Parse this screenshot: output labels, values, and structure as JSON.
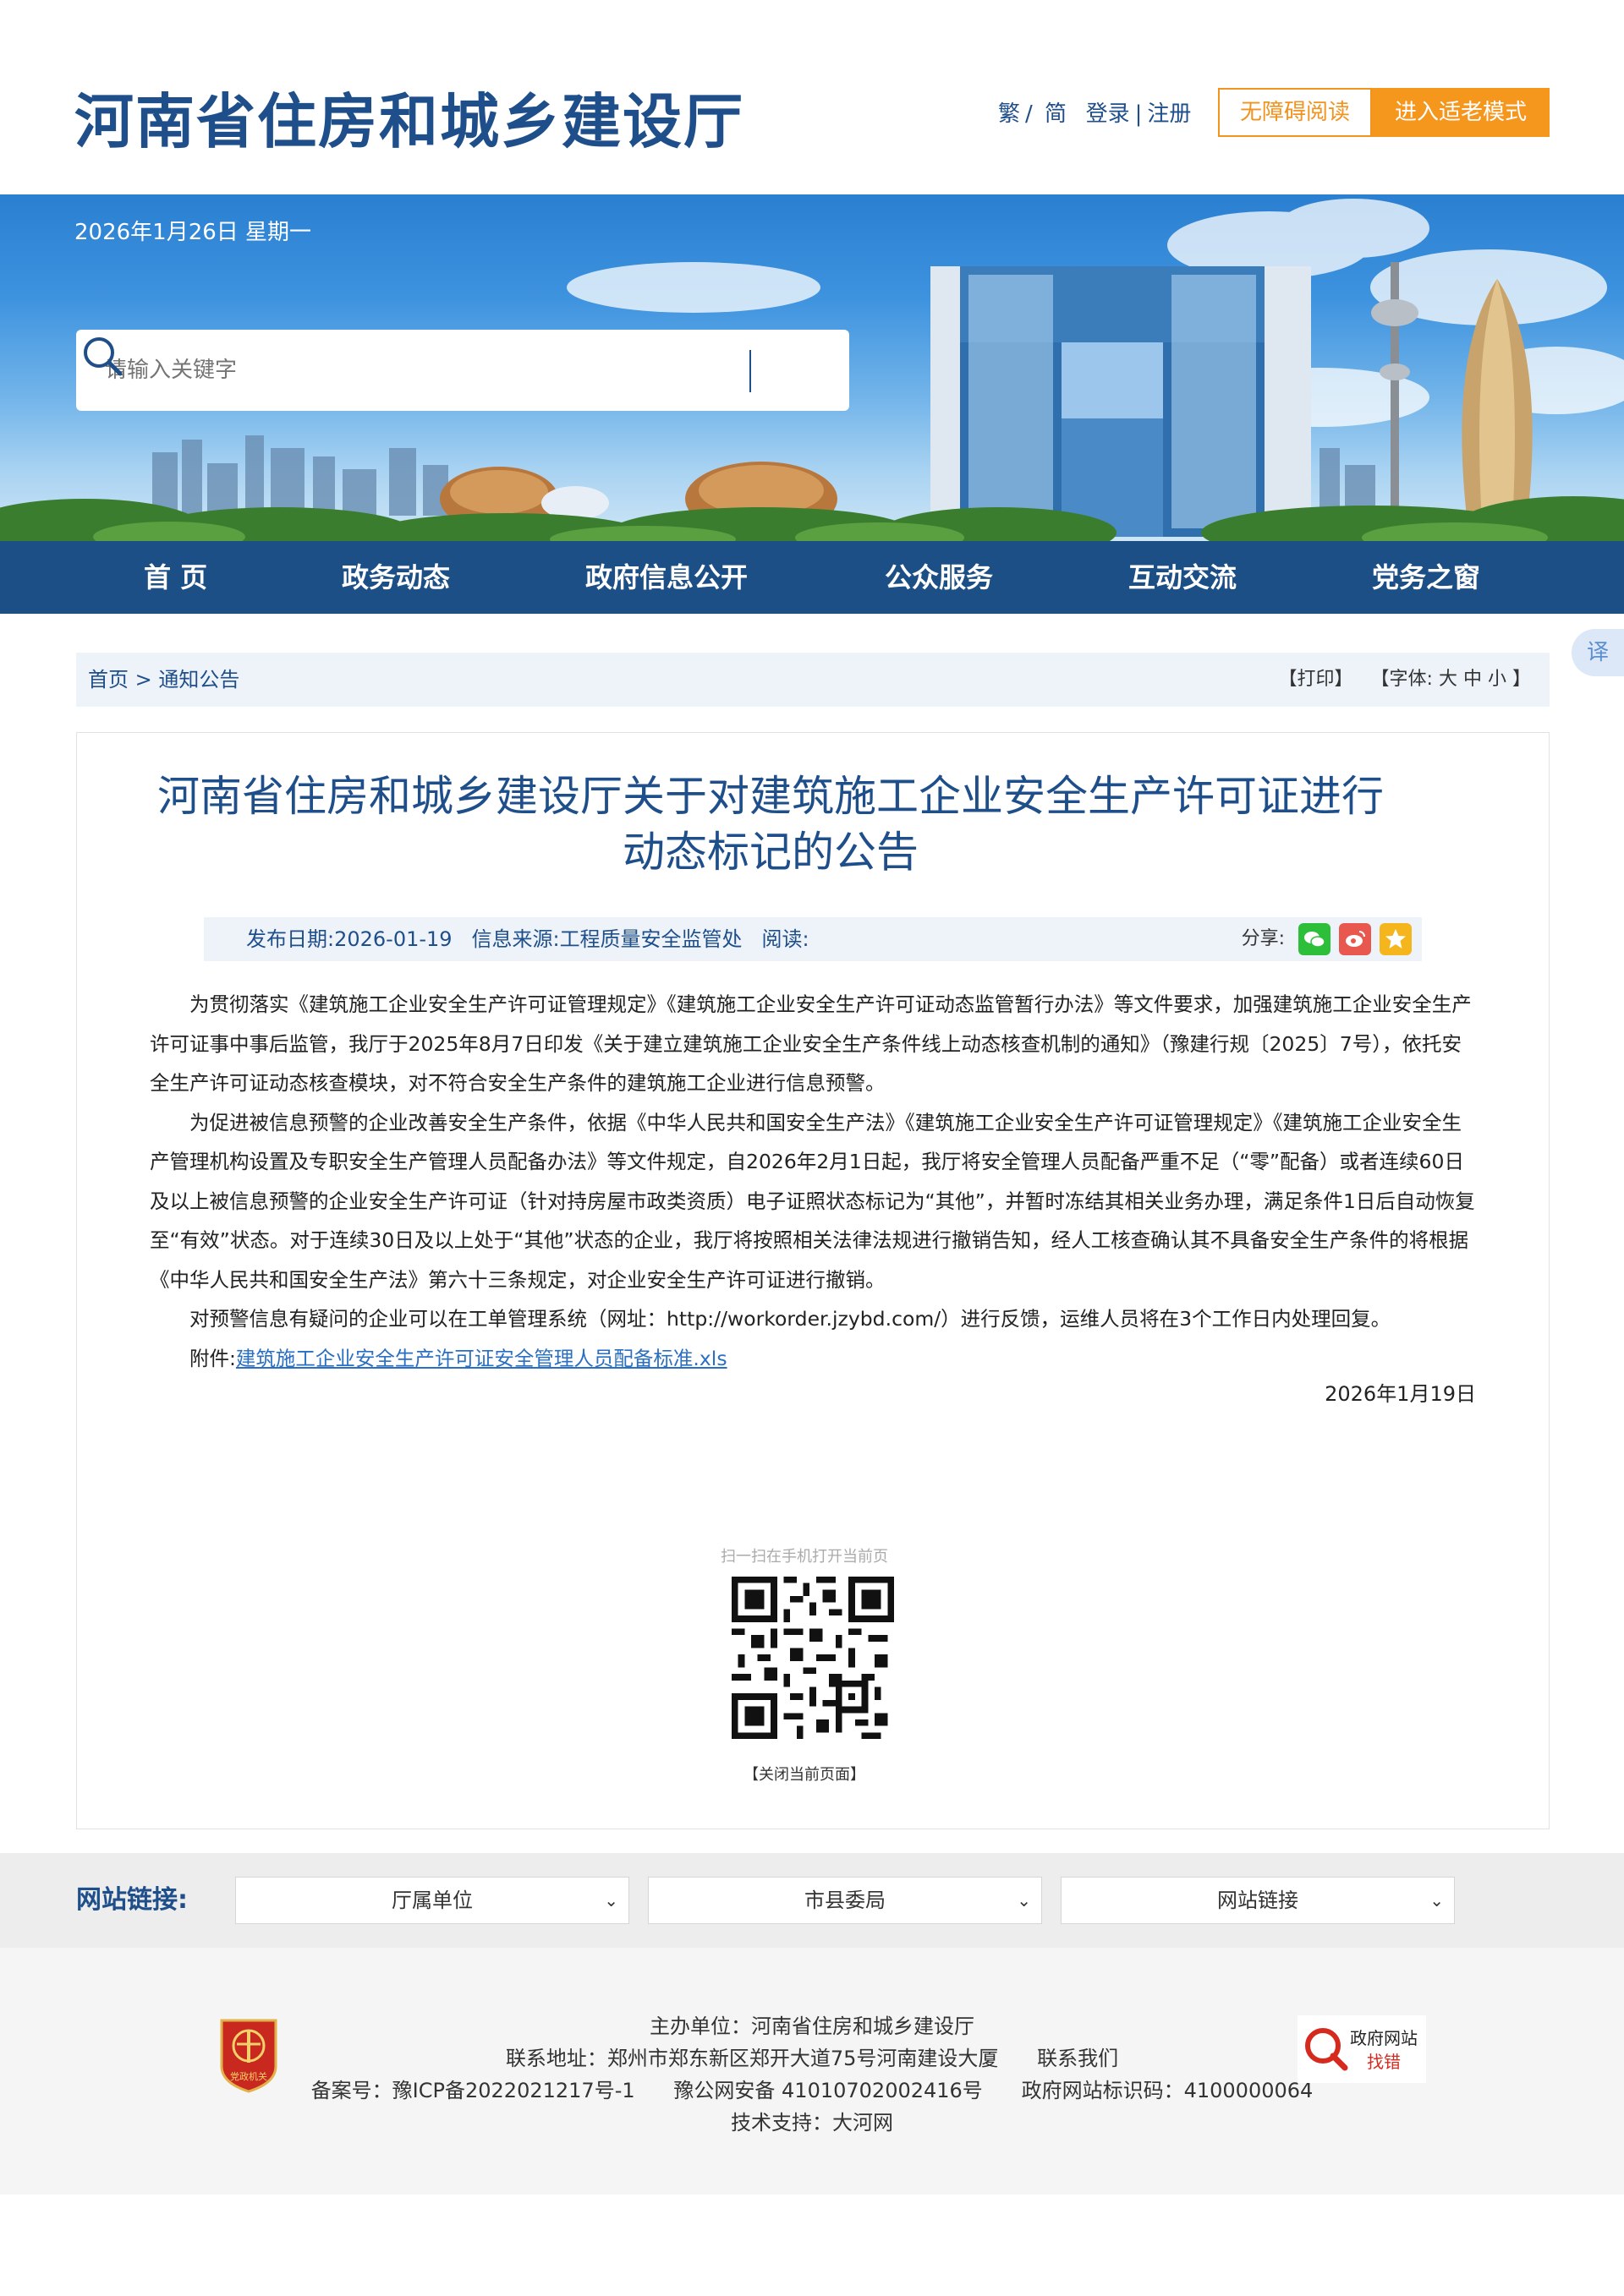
{
  "header": {
    "site_title": "河南省住房和城乡建设厅",
    "lang_traditional": "繁",
    "lang_separator": "/",
    "lang_simplified": "简",
    "login": "登录",
    "auth_separator": "|",
    "register": "注册",
    "accessible_reading": "无障碍阅读",
    "elder_mode": "进入适老模式"
  },
  "banner": {
    "date": "2026年1月26日 星期一"
  },
  "search": {
    "placeholder": "请输入关键字"
  },
  "nav": {
    "items": [
      "首 页",
      "政务动态",
      "政府信息公开",
      "公众服务",
      "互动交流",
      "党务之窗"
    ]
  },
  "translate": {
    "label": "译"
  },
  "breadcrumb": {
    "home": "首页",
    "separator": ">",
    "current": "通知公告",
    "print": "【打印】",
    "font_label": "【字体:",
    "font_large": "大",
    "font_medium": "中",
    "font_small": "小",
    "font_close": "】"
  },
  "article": {
    "title_line1": "河南省住房和城乡建设厅关于对建筑施工企业安全生产许可证进行",
    "title_line2": "动态标记的公告",
    "publish_label": "发布日期:",
    "publish_date": "2026-01-19",
    "source_label": "信息来源:",
    "source": "工程质量安全监管处",
    "views_label": "阅读:",
    "share_label": "分享:",
    "paragraphs": [
      "为贯彻落实《建筑施工企业安全生产许可证管理规定》《建筑施工企业安全生产许可证动态监管暂行办法》等文件要求，加强建筑施工企业安全生产许可证事中事后监管，我厅于2025年8月7日印发《关于建立建筑施工企业安全生产条件线上动态核查机制的通知》（豫建行规〔2025〕7号），依托安全生产许可证动态核查模块，对不符合安全生产条件的建筑施工企业进行信息预警。",
      "为促进被信息预警的企业改善安全生产条件，依据《中华人民共和国安全生产法》《建筑施工企业安全生产许可证管理规定》《建筑施工企业安全生产管理机构设置及专职安全生产管理人员配备办法》等文件规定，自2026年2月1日起，我厅将安全管理人员配备严重不足（“零”配备）或者连续60日及以上被信息预警的企业安全生产许可证（针对持房屋市政类资质）电子证照状态标记为“其他”，并暂时冻结其相关业务办理，满足条件1日后自动恢复至“有效”状态。对于连续30日及以上处于“其他”状态的企业，我厅将按照相关法律法规进行撤销告知，经人工核查确认其不具备安全生产条件的将根据《中华人民共和国安全生产法》第六十三条规定，对企业安全生产许可证进行撤销。",
      "对预警信息有疑问的企业可以在工单管理系统（网址：http://workorder.jzybd.com/）进行反馈，运维人员将在3个工作日内处理回复。"
    ],
    "attachment_label": "附件:",
    "attachment_link": "建筑施工企业安全生产许可证安全管理人员配备标准.xls",
    "date": "2026年1月19日",
    "qr_caption": "扫一扫在手机打开当前页",
    "close_page": "【关闭当前页面】"
  },
  "links": {
    "label": "网站链接:",
    "selects": [
      "厅属单位",
      "市县委局",
      "网站链接"
    ]
  },
  "footer": {
    "host": "主办单位：河南省住房和城乡建设厅",
    "address": "联系地址：郑州市郑东新区郑开大道75号河南建设大厦",
    "contact": "联系我们",
    "icp": "备案号：豫ICP备2022021217号-1",
    "police": "豫公网安备 41010702002416号",
    "site_id": "政府网站标识码：4100000064",
    "tech_support": "技术支持：大河网",
    "emblem_text": "党政机关",
    "gov_find_error_line1": "政府网站",
    "gov_find_error_line2": "找错"
  },
  "colors": {
    "brand_blue": "#1f4f8a",
    "nav_blue": "#1c4f86",
    "accent_orange": "#f5961d",
    "wechat_green": "#2dbf3a",
    "weibo_red": "#e8584e",
    "favorite_yellow": "#f5b51d"
  }
}
